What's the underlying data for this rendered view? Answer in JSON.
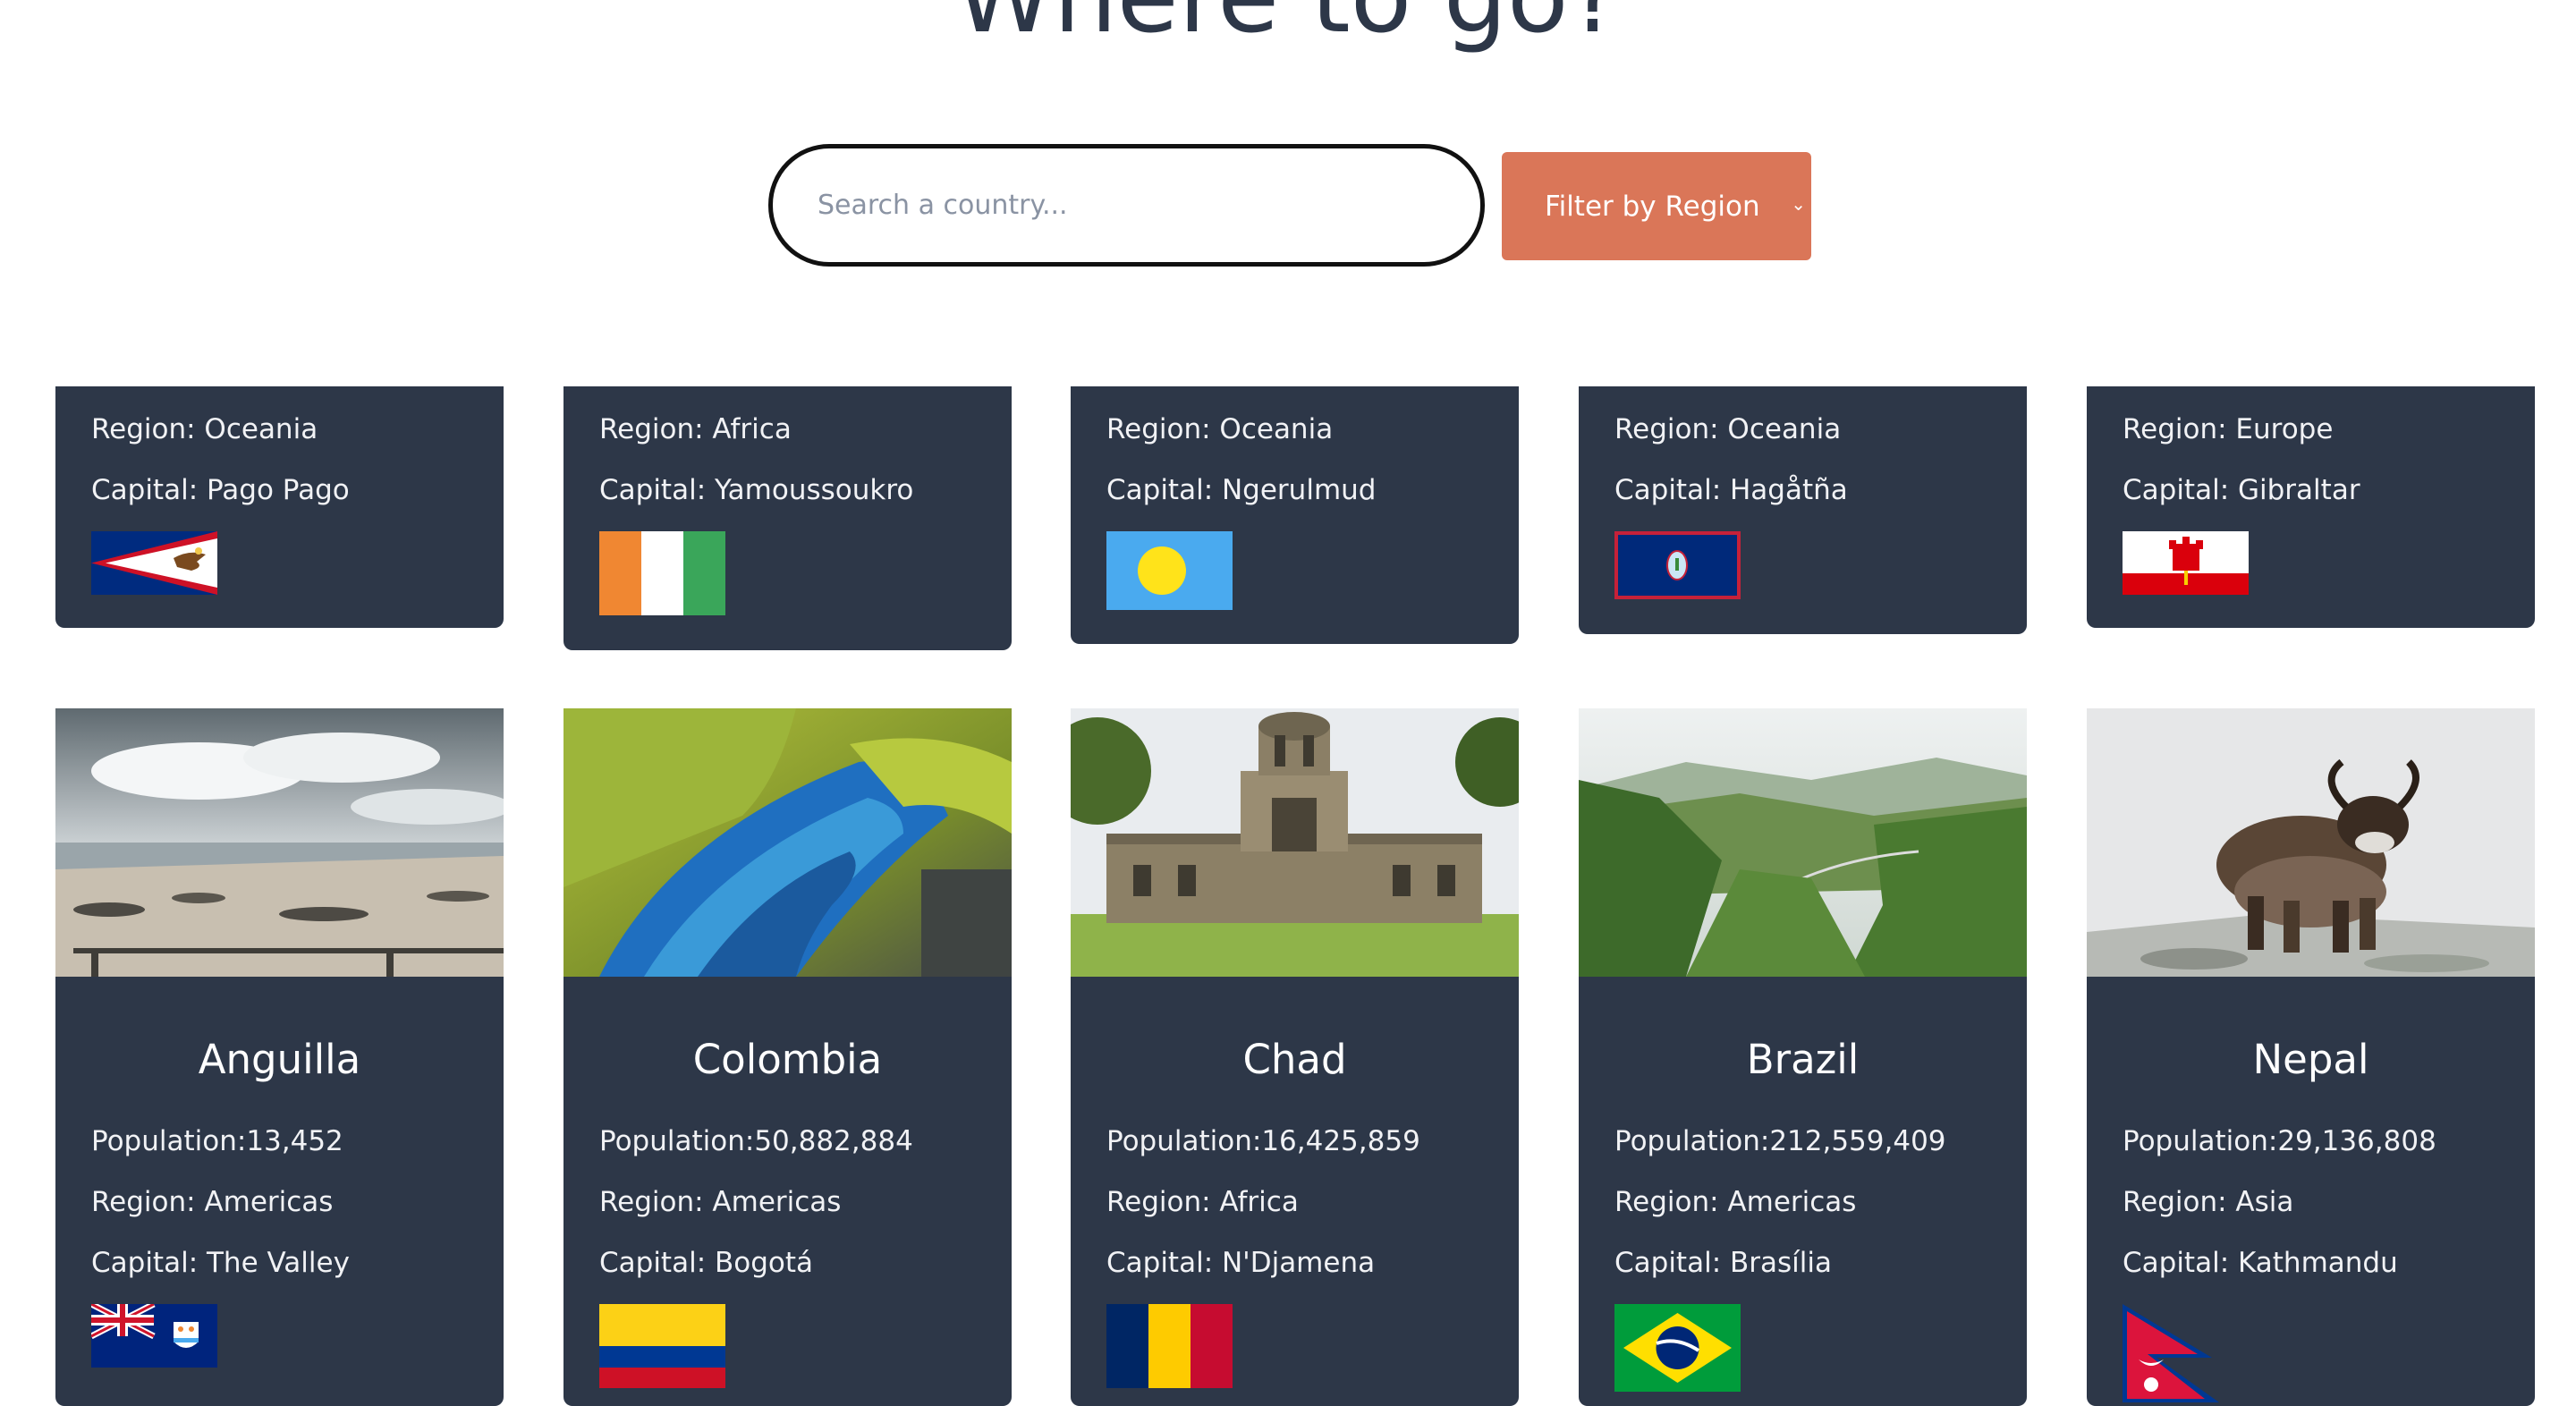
{
  "header": {
    "title": "Where to go?"
  },
  "search": {
    "placeholder": "Search a country..."
  },
  "filter": {
    "label": "Filter by Region",
    "chevron_icon": "chevron-down-icon"
  },
  "top_row": [
    {
      "region": "Region: Oceania",
      "capital": "Capital: Pago Pago",
      "flag": "american-samoa-flag"
    },
    {
      "region": "Region: Africa",
      "capital": "Capital: Yamoussoukro",
      "flag": "ivory-coast-flag"
    },
    {
      "region": "Region: Oceania",
      "capital": "Capital: Ngerulmud",
      "flag": "palau-flag"
    },
    {
      "region": "Region: Oceania",
      "capital": "Capital: Hagåtña",
      "flag": "guam-flag"
    },
    {
      "region": "Region: Europe",
      "capital": "Capital: Gibraltar",
      "flag": "gibraltar-flag"
    }
  ],
  "cards": [
    {
      "name": "Anguilla",
      "population": "Population:13,452",
      "region": "Region: Americas",
      "capital": "Capital: The Valley",
      "photo": "beach-photo",
      "flag": "anguilla-flag"
    },
    {
      "name": "Colombia",
      "population": "Population:50,882,884",
      "region": "Region: Americas",
      "capital": "Capital: Bogotá",
      "photo": "macaw-feathers-photo",
      "flag": "colombia-flag"
    },
    {
      "name": "Chad",
      "population": "Population:16,425,859",
      "region": "Region: Africa",
      "capital": "Capital: N'Djamena",
      "photo": "stone-tower-building-photo",
      "flag": "chad-flag"
    },
    {
      "name": "Brazil",
      "population": "Population:212,559,409",
      "region": "Region: Americas",
      "capital": "Capital: Brasília",
      "photo": "green-mountains-valley-photo",
      "flag": "brazil-flag"
    },
    {
      "name": "Nepal",
      "population": "Population:29,136,808",
      "region": "Region: Asia",
      "capital": "Capital: Kathmandu",
      "photo": "yak-photo",
      "flag": "nepal-flag"
    }
  ],
  "colors": {
    "card": "#2d3748",
    "filter": "#da7658",
    "text": "#ffffff"
  }
}
